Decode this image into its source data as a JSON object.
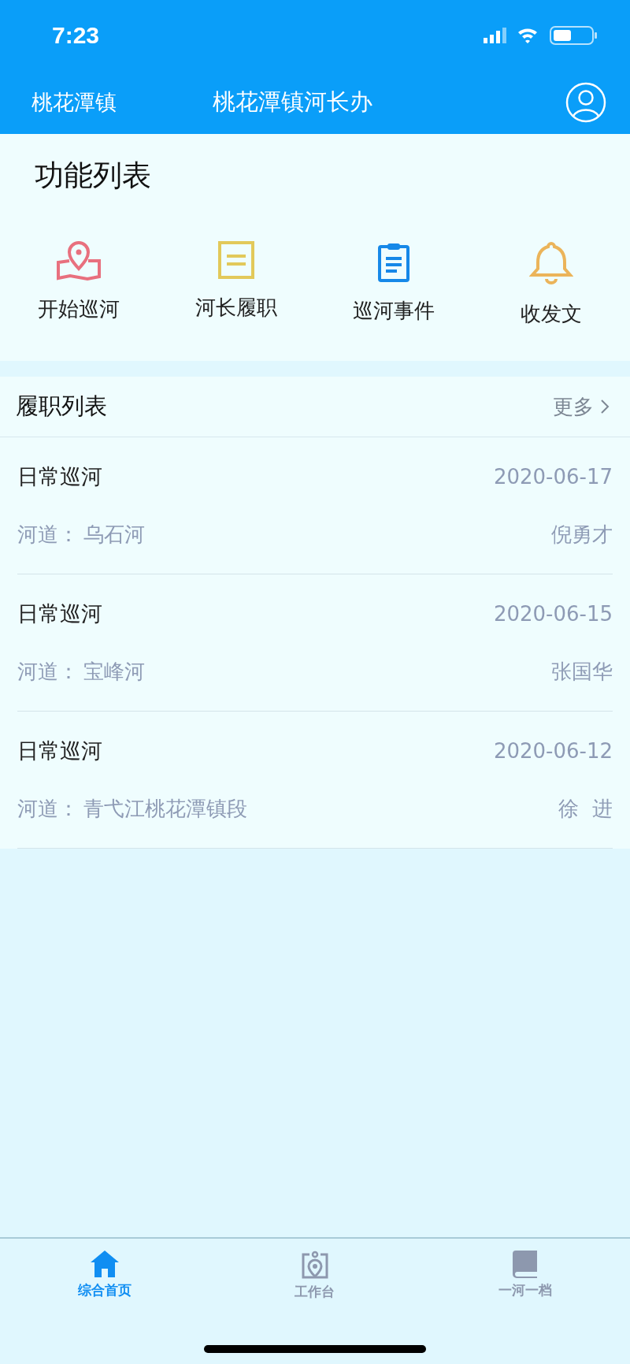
{
  "status_bar": {
    "time": "7:23"
  },
  "nav": {
    "left": "桃花潭镇",
    "title": "桃花潭镇河长办"
  },
  "functions": {
    "title": "功能列表",
    "items": [
      {
        "kind": "map",
        "label": "开始巡河",
        "color": "#e8707e"
      },
      {
        "kind": "doc",
        "label": "河长履职",
        "color": "#e2c95a"
      },
      {
        "kind": "clipboard",
        "label": "巡河事件",
        "color": "#1688e8"
      },
      {
        "kind": "bell",
        "label": "收发文",
        "color": "#ebb45a"
      }
    ]
  },
  "duties": {
    "title": "履职列表",
    "more": "更多",
    "rows": [
      {
        "type": "日常巡河",
        "date": "2020-06-17",
        "river_label": "河道：",
        "river": "乌石河",
        "person": "倪勇才"
      },
      {
        "type": "日常巡河",
        "date": "2020-06-15",
        "river_label": "河道：",
        "river": "宝峰河",
        "person": "张国华"
      },
      {
        "type": "日常巡河",
        "date": "2020-06-12",
        "river_label": "河道：",
        "river": "青弋江桃花潭镇段",
        "person": "徐  进"
      }
    ]
  },
  "tab_bar": [
    {
      "kind": "home",
      "label": "综合首页",
      "selected": true
    },
    {
      "kind": "work",
      "label": "工作台",
      "selected": false
    },
    {
      "kind": "book",
      "label": "一河一档",
      "selected": false
    }
  ]
}
